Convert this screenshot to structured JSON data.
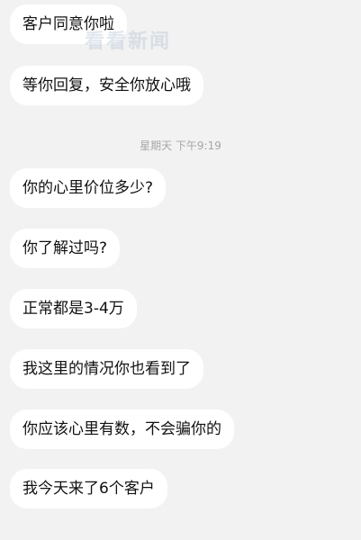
{
  "messages": [
    "客户同意你啦",
    "等你回复，安全你放心哦",
    "你的心里价位多少?",
    "你了解过吗?",
    "正常都是3-4万",
    "我这里的情况你也看到了",
    "你应该心里有数，不会骗你的",
    "我今天来了6个客户"
  ],
  "timestamp": "星期天 下午9:19",
  "watermark": "看看新闻",
  "colors": {
    "background": "#f2f2f2",
    "bubble": "#ffffff",
    "timestamp": "#a6a6a6"
  }
}
